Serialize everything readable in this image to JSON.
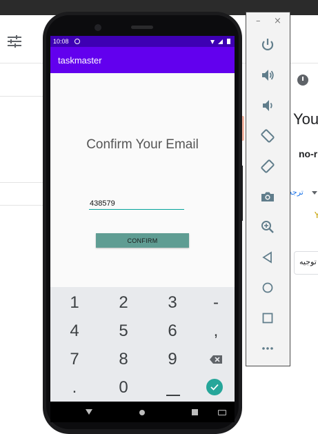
{
  "background": {
    "right_texts": {
      "partial_heading": "You",
      "partial_bold": "no-r",
      "rtl_link": "ترجه",
      "rtl_box": "توجیه",
      "partial_y": "Y"
    }
  },
  "phone": {
    "status_bar": {
      "time": "10:08"
    },
    "app_bar": {
      "title": "taskmaster"
    },
    "main": {
      "heading": "Confirm Your Email",
      "code_input": {
        "value": "438579",
        "placeholder": ""
      },
      "confirm_button": "CONFIRM"
    },
    "keypad": {
      "keys": [
        [
          "1",
          "2",
          "3",
          "-"
        ],
        [
          "4",
          "5",
          "6",
          ","
        ],
        [
          "7",
          "8",
          "9",
          "backspace-icon"
        ],
        [
          ".",
          "0",
          "space-icon",
          "check-icon"
        ]
      ]
    },
    "nav_bar": {
      "buttons": [
        "back-icon",
        "home-icon",
        "recents-icon",
        "keyboard-icon"
      ]
    }
  },
  "emulator_panel": {
    "window_controls": [
      "minimize-icon",
      "close-icon"
    ],
    "minimize_label": "–",
    "close_label": "×",
    "controls": [
      "power-icon",
      "volume-up-icon",
      "volume-down-icon",
      "rotate-left-icon",
      "rotate-right-icon",
      "camera-icon",
      "zoom-icon",
      "back-icon",
      "home-icon",
      "overview-icon",
      "more-icon"
    ]
  },
  "colors": {
    "status_bar": "#3e00b3",
    "app_bar": "#6200ee",
    "confirm_button": "#5f9d93",
    "input_underline": "#00a29a",
    "keypad_bg": "#e8eaed",
    "check_key": "#26a69a",
    "panel_icon": "#607d8b"
  }
}
